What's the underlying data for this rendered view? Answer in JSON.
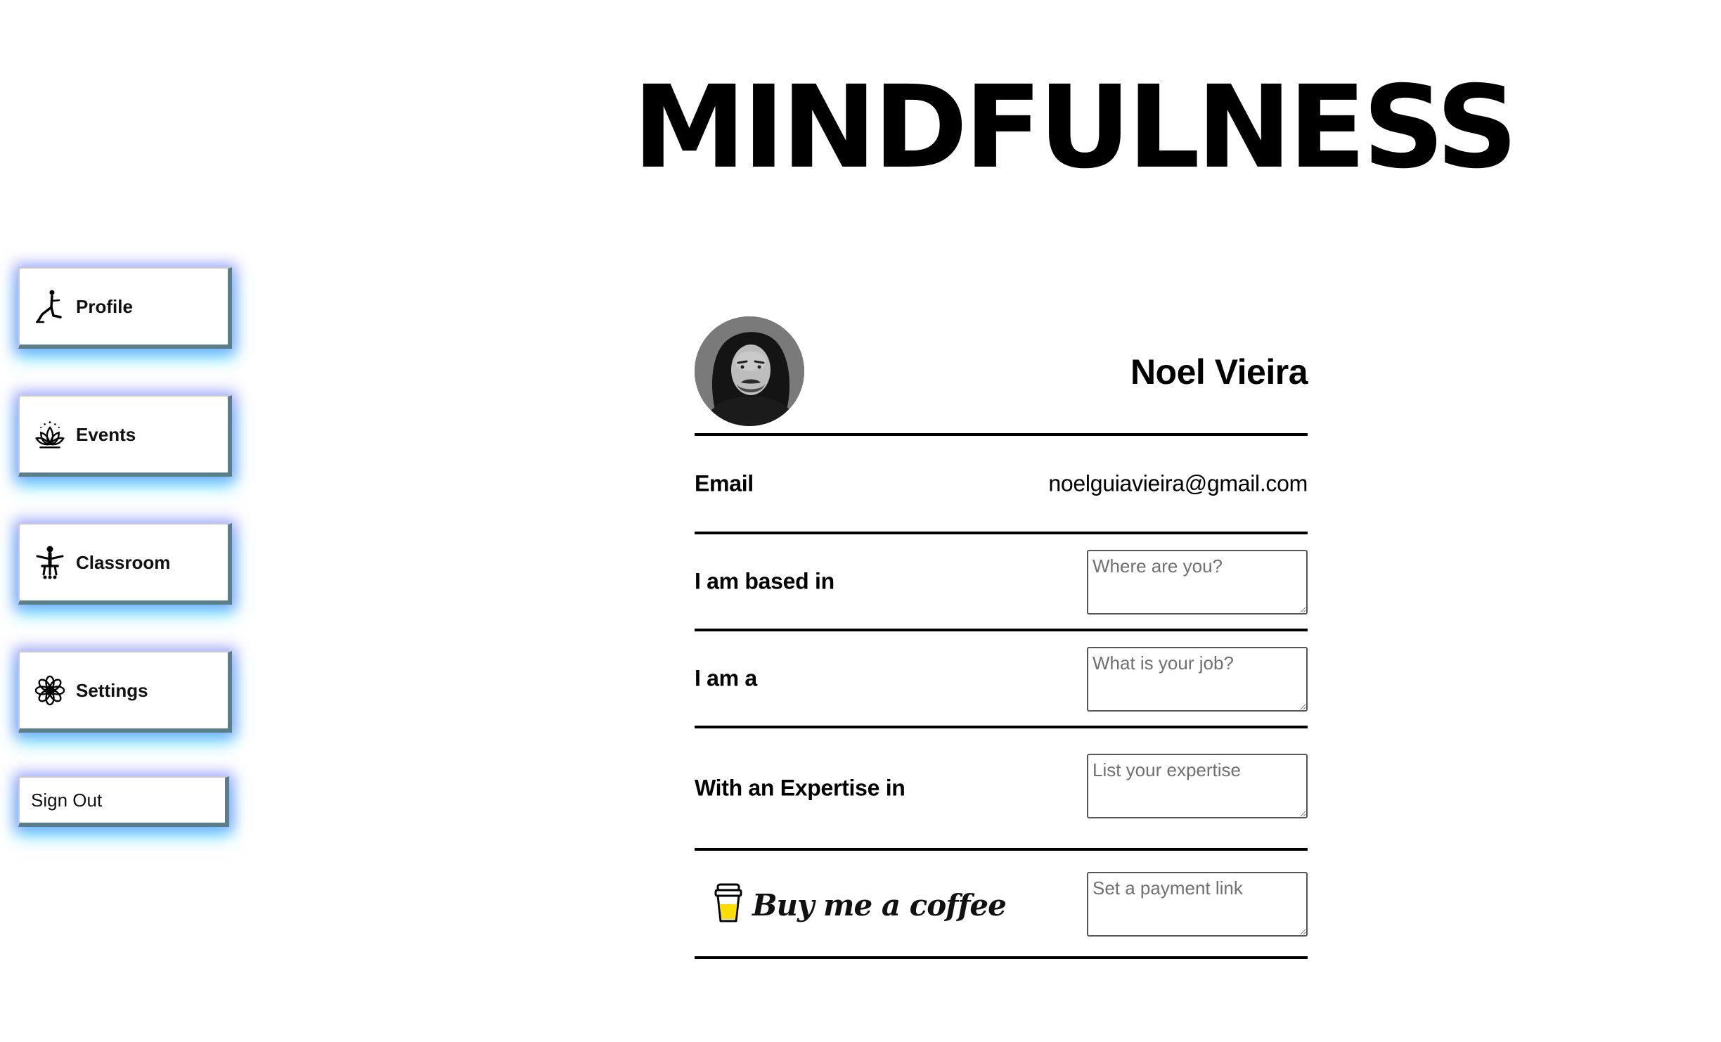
{
  "app": {
    "title": "MINDFULNESS"
  },
  "sidebar": {
    "items": [
      {
        "label": "Profile",
        "icon": "yoga-pose-icon"
      },
      {
        "label": "Events",
        "icon": "lotus-icon"
      },
      {
        "label": "Classroom",
        "icon": "meditation-teacher-icon"
      },
      {
        "label": "Settings",
        "icon": "flower-gear-icon"
      }
    ],
    "sign_out_label": "Sign Out"
  },
  "profile": {
    "name": "Noel Vieira",
    "email_label": "Email",
    "email_value": "noelguiavieira@gmail.com",
    "based_label": "I am based in",
    "based_placeholder": "Where are you?",
    "job_label": "I am a",
    "job_placeholder": "What is your job?",
    "expertise_label": "With an Expertise in",
    "expertise_placeholder": "List your expertise",
    "coffee_brand": "Buy me a coffee",
    "payment_placeholder": "Set a payment link"
  },
  "colors": {
    "button_glow": "#7369ff",
    "button_glow_secondary": "#00e1ff",
    "button_edge": "#5a7f8a",
    "coffee_fill": "#ffdd00"
  }
}
